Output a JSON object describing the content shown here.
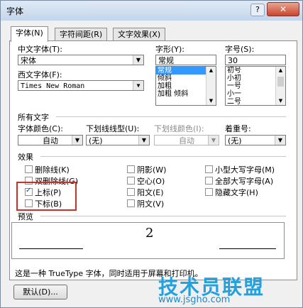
{
  "window": {
    "title": "字体",
    "help": "?",
    "close": "✕"
  },
  "tabs": [
    {
      "label": "字体(N)"
    },
    {
      "label": "字符间距(R)"
    },
    {
      "label": "文字效果(X)"
    }
  ],
  "chinese_font": {
    "label": "中文字体(T):",
    "value": "宋体"
  },
  "western_font": {
    "label": "西文字体(F):",
    "value": "Times New Roman"
  },
  "font_style": {
    "label": "字形(Y):",
    "value": "常规",
    "options": [
      "常规",
      "倾斜",
      "加粗",
      "加粗 倾斜"
    ],
    "selected_index": 0
  },
  "font_size": {
    "label": "字号(S):",
    "value": "30",
    "options": [
      "初号",
      "小初",
      "一号",
      "小一",
      "二号"
    ]
  },
  "all_text": {
    "section": "所有文字",
    "font_color_label": "字体颜色(C):",
    "font_color_value": "自动",
    "underline_label": "下划线线型(U):",
    "underline_value": "(无)",
    "underline_color_label": "下划线颜色(I):",
    "underline_color_value": "自动",
    "emphasis_label": "着重号:",
    "emphasis_value": "(无)"
  },
  "effects": {
    "section": "效果",
    "items": [
      {
        "label": "删除线(K)",
        "checked": false
      },
      {
        "label": "双删除线(G)",
        "checked": false
      },
      {
        "label": "上标(P)",
        "checked": true
      },
      {
        "label": "下标(B)",
        "checked": false
      },
      {
        "label": "阴影(W)",
        "checked": false
      },
      {
        "label": "空心(O)",
        "checked": false
      },
      {
        "label": "阳文(E)",
        "checked": false
      },
      {
        "label": "阴文(V)",
        "checked": false
      },
      {
        "label": "小型大写字母(M)",
        "checked": false
      },
      {
        "label": "全部大写字母(A)",
        "checked": false
      },
      {
        "label": "隐藏文字(H)",
        "checked": false
      }
    ]
  },
  "preview": {
    "section": "预览",
    "sample": "2"
  },
  "note": "这是一种 TrueType 字体，同时适用于屏幕和打印机。",
  "default_button": "默认(D)...",
  "watermark": {
    "main": "技术员联盟",
    "url": "www.jsgho.com"
  }
}
